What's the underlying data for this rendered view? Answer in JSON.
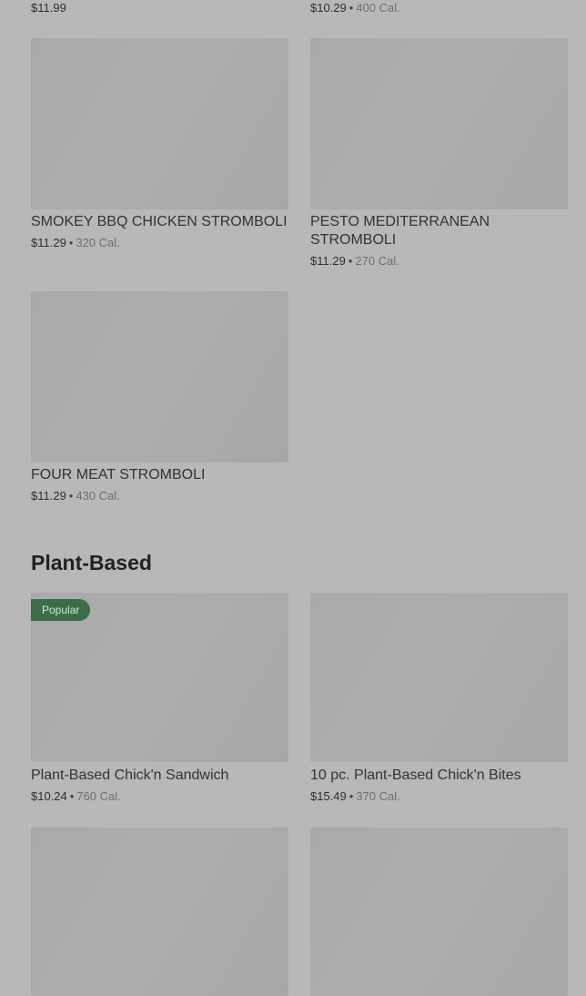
{
  "top_partial": {
    "left": {
      "price": "$11.99"
    },
    "right": {
      "price": "$10.29",
      "calories": "400 Cal."
    }
  },
  "rows": [
    {
      "left": {
        "title": "SMOKEY BBQ CHICKEN STROMBOLI",
        "price": "$11.29",
        "calories": "320 Cal."
      },
      "right": {
        "title": "PESTO MEDITERRANEAN STROMBOLI",
        "price": "$11.29",
        "calories": "270 Cal."
      }
    },
    {
      "left": {
        "title": "FOUR MEAT STROMBOLI",
        "price": "$11.29",
        "calories": "430 Cal."
      }
    }
  ],
  "plant_section": {
    "title": "Plant-Based",
    "items": [
      {
        "badge": "Popular",
        "title": "Plant-Based Chick'n Sandwich",
        "price": "$10.24",
        "calories": "760 Cal."
      },
      {
        "title": "10 pc. Plant-Based Chick'n Bites",
        "price": "$15.49",
        "calories": "370 Cal."
      }
    ]
  },
  "separator": "•"
}
